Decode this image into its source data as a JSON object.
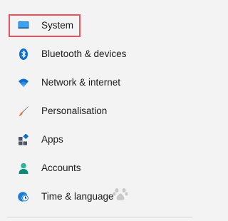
{
  "nav": {
    "items": [
      {
        "label": "System",
        "icon": "display-icon"
      },
      {
        "label": "Bluetooth & devices",
        "icon": "bluetooth-icon"
      },
      {
        "label": "Network & internet",
        "icon": "wifi-icon"
      },
      {
        "label": "Personalisation",
        "icon": "brush-icon"
      },
      {
        "label": "Apps",
        "icon": "apps-icon"
      },
      {
        "label": "Accounts",
        "icon": "person-icon"
      },
      {
        "label": "Time & language",
        "icon": "clock-globe-icon"
      }
    ]
  },
  "colors": {
    "background": "#f3f3f3",
    "highlight_border": "#e8545e",
    "accent": "#0067c0",
    "text": "#1b1b1b"
  }
}
